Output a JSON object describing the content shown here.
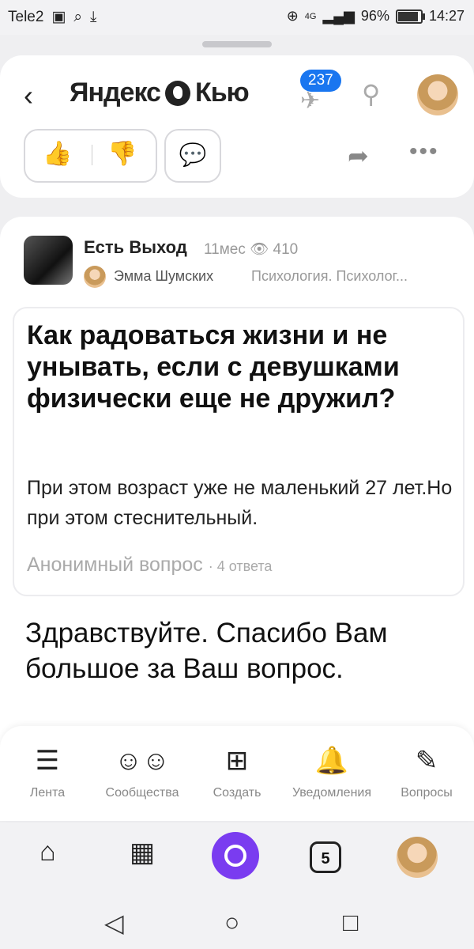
{
  "status": {
    "carrier": "Tele2",
    "battery": "96%",
    "time": "14:27",
    "network": "4G"
  },
  "header": {
    "logo": "Яндекс",
    "logo2": "Кью",
    "badge": "237"
  },
  "actions": {
    "up": "👍",
    "down": "👎"
  },
  "post": {
    "community": "Есть Выход",
    "age": "11мес",
    "views": "410",
    "author": "Эмма Шумских",
    "topic": "Психология. Психолог...",
    "question_title": "Как радоваться жизни и не унывать, если с девушками физически еще не дружил?",
    "question_text": "При этом возраст уже не маленький 27 лет.Но при этом стеснительный.",
    "question_author": "Анонимный вопрос",
    "answers_count": "4 ответа",
    "answer_text": "Здравствуйте. Спасибо Вам большое за Ваш вопрос."
  },
  "tabs": [
    {
      "label": "Лента"
    },
    {
      "label": "Сообщества"
    },
    {
      "label": "Создать"
    },
    {
      "label": "Уведомления"
    },
    {
      "label": "Вопросы"
    }
  ],
  "browser": {
    "tabs_count": "5"
  },
  "icons": [
    "back-icon",
    "search-icon",
    "share-icon",
    "more-icon",
    "home-icon",
    "apps-icon",
    "alice-icon",
    "back-nav-icon",
    "home-nav-icon",
    "recents-nav-icon"
  ]
}
